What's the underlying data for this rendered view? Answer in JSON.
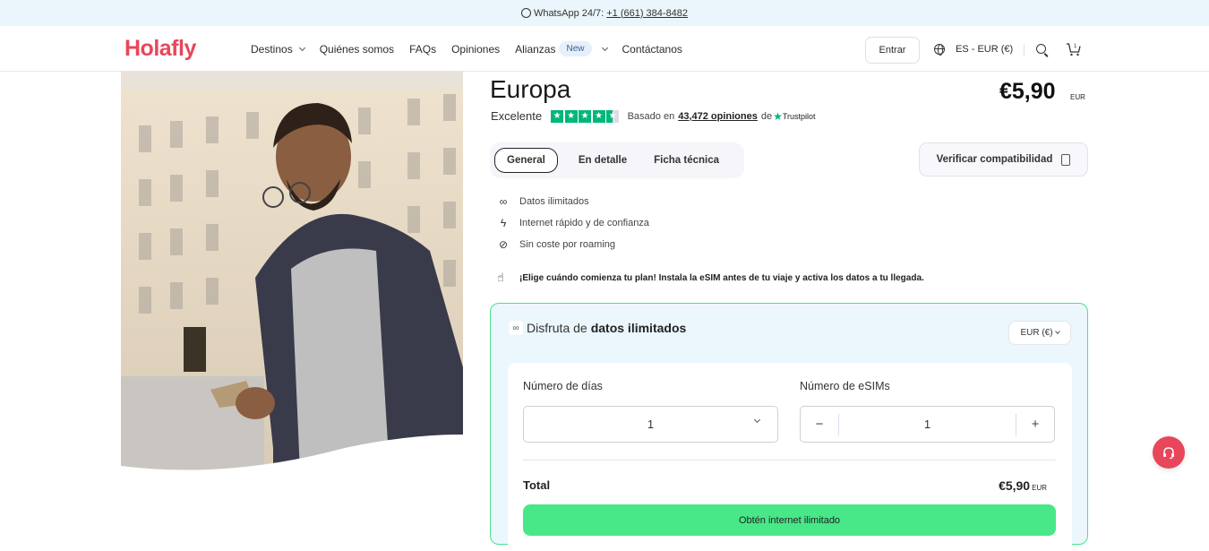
{
  "topbar": {
    "whatsapp_label": "WhatsApp 24/7:",
    "whatsapp_phone": "+1 (661) 384-8482"
  },
  "header": {
    "logo": "Holafly",
    "nav": [
      {
        "label": "Destinos",
        "has_dropdown": true
      },
      {
        "label": "Quiénes somos"
      },
      {
        "label": "FAQs"
      },
      {
        "label": "Opiniones"
      },
      {
        "label": "Alianzas",
        "badge": "New",
        "has_dropdown": true
      },
      {
        "label": "Contáctanos"
      }
    ],
    "login_label": "Entrar",
    "locale_label": "ES - EUR (€)",
    "cart_count": "1"
  },
  "product": {
    "title": "Europa",
    "price": "€5,90",
    "price_currency": "EUR",
    "rating_label": "Excelente",
    "rating_stars": 4.5,
    "rating_based_on": "Basado en",
    "rating_count_link": "43,472 opiniones",
    "rating_source_prefix": "de",
    "rating_source": "Trustpilot"
  },
  "tabs": [
    {
      "label": "General",
      "active": true
    },
    {
      "label": "En detalle",
      "active": false
    },
    {
      "label": "Ficha técnica",
      "active": false
    }
  ],
  "verify_button": "Verificar compatibilidad",
  "features": [
    {
      "icon": "infinity-icon",
      "glyph": "∞",
      "label": "Datos ilimitados"
    },
    {
      "icon": "lightning-icon",
      "glyph": "ϟ",
      "label": "Internet rápido y de confianza"
    },
    {
      "icon": "no-roaming-icon",
      "glyph": "⊘",
      "label": "Sin coste por roaming"
    }
  ],
  "notice": "¡Elige cuándo comienza tu plan! Instala la eSIM antes de tu viaje y activa los datos a tu llegada.",
  "plan_card": {
    "heading_prefix": "Disfruta de",
    "heading_bold": "datos ilimitados",
    "currency_select": "EUR (€)",
    "days_label": "Número de días",
    "days_value": "1",
    "esims_label": "Número de eSIMs",
    "esims_value": "1",
    "decrement": "−",
    "increment": "+",
    "total_label": "Total",
    "total_value": "€5,90",
    "total_currency": "EUR",
    "cta_label": "Obtén internet ilimitado"
  },
  "colors": {
    "brand": "#e8465b",
    "cta": "#48e888",
    "card_bg": "#ebf7fd",
    "trustpilot": "#00b67a"
  }
}
